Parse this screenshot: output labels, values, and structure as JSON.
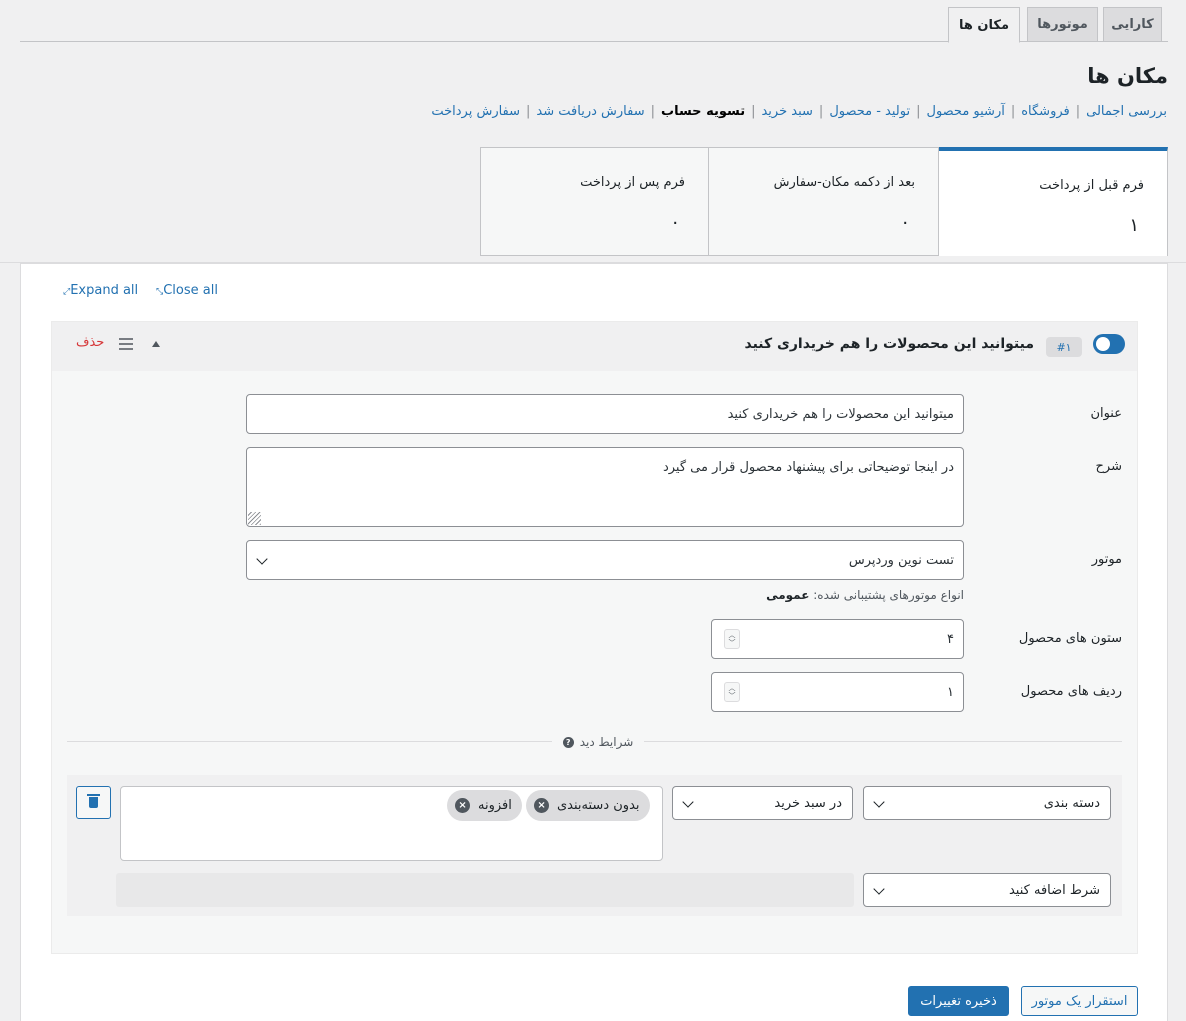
{
  "nav_tabs": [
    "کارایی",
    "موتورها",
    "مکان ها"
  ],
  "page_title": "مکان ها",
  "subsub": [
    "بررسی اجمالی",
    "فروشگاه",
    "آرشیو محصول",
    "تولید - محصول",
    "سبد خرید",
    "تسویه حساب",
    "سفارش دریافت شد",
    "سفارش پرداخت"
  ],
  "stats": [
    {
      "label": "فرم قبل از پرداخت",
      "value": "۱"
    },
    {
      "label": "بعد از دکمه مکان-سفارش",
      "value": "۰"
    },
    {
      "label": "فرم پس از پرداخت",
      "value": "۰"
    }
  ],
  "actions": {
    "expand_all": "Expand all",
    "close_all": "Close all"
  },
  "box": {
    "badge": "#۱",
    "title": "میتوانید این محصولات را هم خریداری کنید",
    "delete": "حذف"
  },
  "fields": {
    "title_label": "عنوان",
    "title_value": "میتوانید این محصولات را هم خریداری کنید",
    "desc_label": "شرح",
    "desc_value": "در اینجا توضیحاتی برای پیشنهاد محصول قرار می گیرد",
    "engine_label": "موتور",
    "engine_value": "تست نوین وردپرس",
    "engine_help": "انواع موتورهای پشتیبانی شده:",
    "engine_help_value": "عمومی",
    "columns_label": "ستون های محصول",
    "columns_value": "۴",
    "rows_label": "ردیف های محصول",
    "rows_value": "۱"
  },
  "conditions": {
    "divider": "شرایط دید",
    "type": "دسته بندی",
    "operator": "در سبد خرید",
    "tags": [
      "بدون دسته‌بندی",
      "افزونه"
    ],
    "add": "شرط اضافه کنید"
  },
  "buttons": {
    "deploy": "استقرار یک موتور",
    "save": "ذخیره تغییرات"
  }
}
